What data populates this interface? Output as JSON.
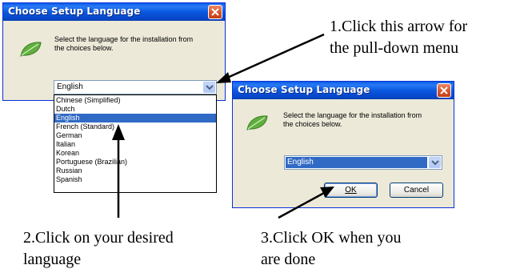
{
  "dialog_main": {
    "title": "Choose Setup Language",
    "instruction_line1": "Select the language for the installation from",
    "instruction_line2": "the choices below.",
    "combo_value": "English",
    "dropdown_options": [
      "Chinese (Simplified)",
      "Dutch",
      "English",
      "French (Standard)",
      "German",
      "Italian",
      "Korean",
      "Portuguese (Brazilian)",
      "Russian",
      "Spanish"
    ],
    "selected_option": "English"
  },
  "dialog_confirm": {
    "title": "Choose Setup Language",
    "instruction_line1": "Select the language for the installation from",
    "instruction_line2": "the choices below.",
    "combo_value": "English",
    "ok_label": "OK",
    "cancel_label": "Cancel"
  },
  "callouts": {
    "step1_line1": "1.Click this arrow for",
    "step1_line2": "the pull-down menu",
    "step2_line1": "2.Click on your desired",
    "step2_line2": "language",
    "step3_line1": "3.Click OK when you",
    "step3_line2": "are done"
  },
  "icons": {
    "close": "close-icon",
    "leaf": "leaf-icon",
    "dropdown_arrow": "chevron-down-icon"
  },
  "colors": {
    "titlebar": "#0a58e0",
    "dialog_bg": "#ece9d8",
    "selection": "#316ac5",
    "close_button": "#d9532c",
    "leaf": "#5fae3e"
  }
}
